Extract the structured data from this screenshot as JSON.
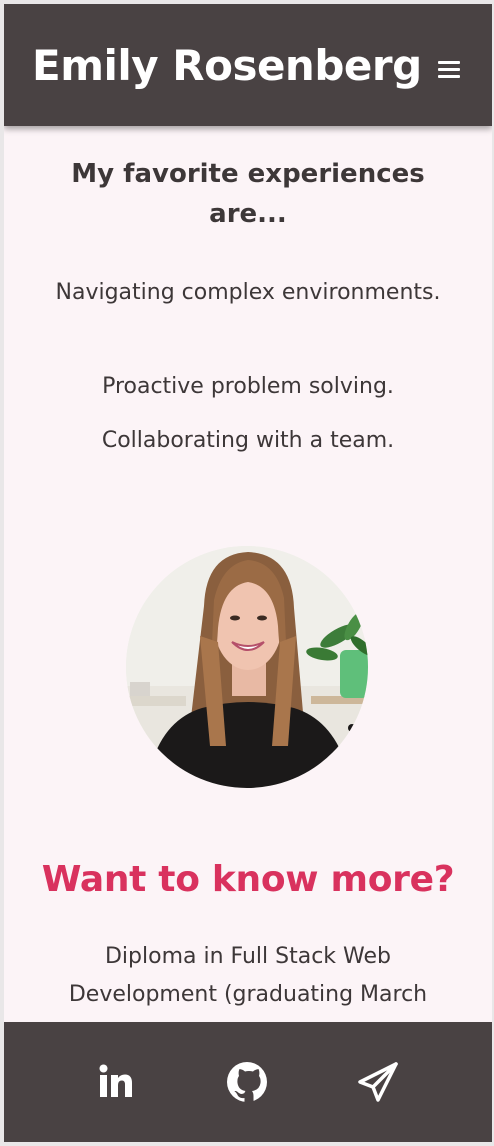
{
  "header": {
    "title": "Emily Rosenberg",
    "menu_icon": "hamburger-menu-icon"
  },
  "experiences": {
    "heading": "My favorite experiences are...",
    "items": [
      "Navigating complex environments.",
      "Proactive problem solving.",
      "Collaborating with a team."
    ]
  },
  "portrait": {
    "icon": "portrait-photo"
  },
  "more": {
    "heading": "Want to know more?",
    "diploma": "Diploma in Full Stack Web Development (graduating March"
  },
  "footer": {
    "links": [
      {
        "icon": "linkedin-icon"
      },
      {
        "icon": "github-icon"
      },
      {
        "icon": "paper-plane-icon"
      }
    ]
  },
  "colors": {
    "header_bg": "#494243",
    "page_bg": "#fcf4f7",
    "accent": "#d9325e",
    "text": "#3d3738"
  }
}
